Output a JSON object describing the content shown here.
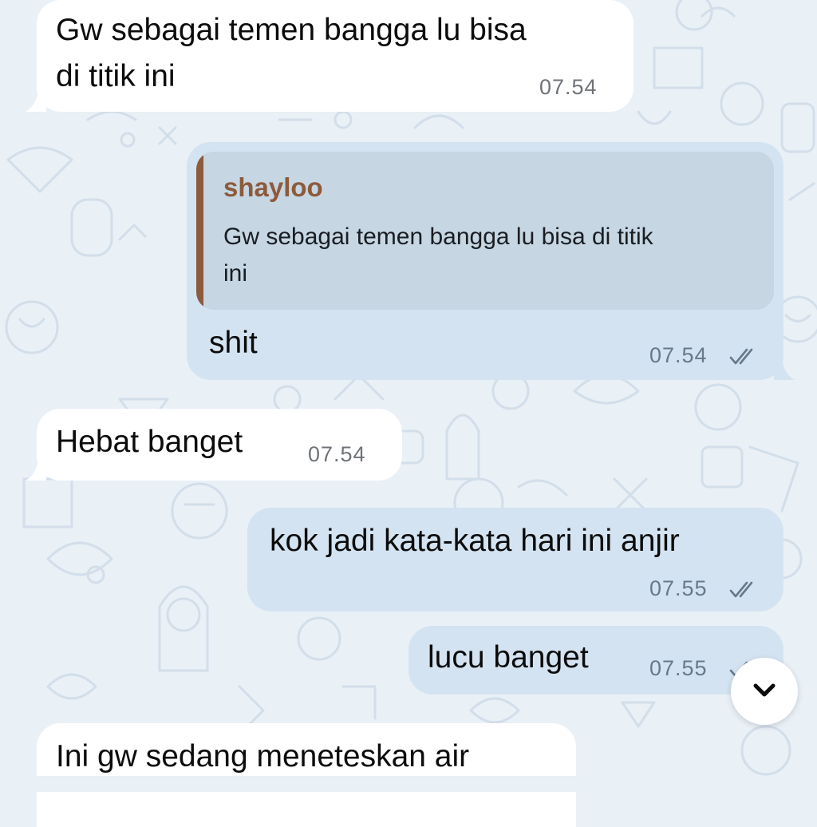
{
  "theme": {
    "incoming_bubble": "#ffffff",
    "outgoing_bubble": "#d4e3f1",
    "quote_accent": "#8d5a3c",
    "wallpaper": "#e9f0f6"
  },
  "messages": [
    {
      "direction": "incoming",
      "lines": [
        "Gw sebagai temen bangga lu bisa",
        "di titik ini"
      ],
      "time": "07.54"
    },
    {
      "direction": "outgoing",
      "reply_to": {
        "sender": "shayloo",
        "lines": [
          "Gw sebagai temen bangga lu bisa di titik",
          "ini"
        ]
      },
      "text": "shit",
      "time": "07.54",
      "status": "read-double-check"
    },
    {
      "direction": "incoming",
      "text": "Hebat banget",
      "time": "07.54"
    },
    {
      "direction": "outgoing",
      "text": "kok jadi kata-kata hari ini anjir",
      "time": "07.55",
      "status": "read-double-check"
    },
    {
      "direction": "outgoing",
      "text": "lucu banget",
      "time": "07.55",
      "status": "read-double-check"
    },
    {
      "direction": "incoming",
      "text": "Ini gw sedang meneteskan air",
      "time": ""
    }
  ],
  "scroll_button": {
    "icon": "chevron-down-icon"
  }
}
